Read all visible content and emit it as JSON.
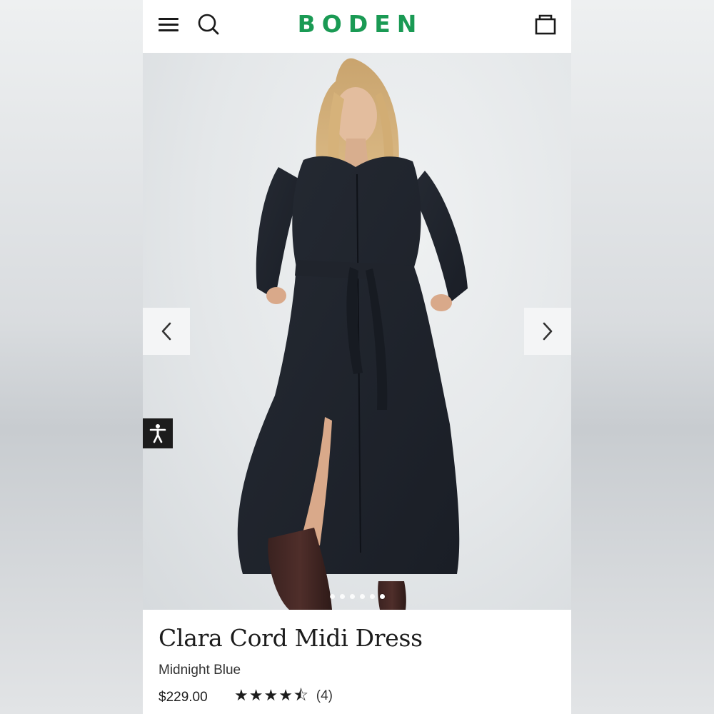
{
  "header": {
    "brand": "BODEN",
    "brand_color": "#1a9a54",
    "icons": [
      "menu-icon",
      "search-icon",
      "shopping-bag-icon"
    ]
  },
  "gallery": {
    "image_count": 6,
    "active_index": 5,
    "prev_icon": "chevron-left-icon",
    "next_icon": "chevron-right-icon",
    "accessibility_icon": "accessibility-icon"
  },
  "product": {
    "name": "Clara Cord Midi Dress",
    "color": "Midnight Blue",
    "price": "$229.00",
    "rating": 4.5,
    "review_count": "(4)"
  }
}
